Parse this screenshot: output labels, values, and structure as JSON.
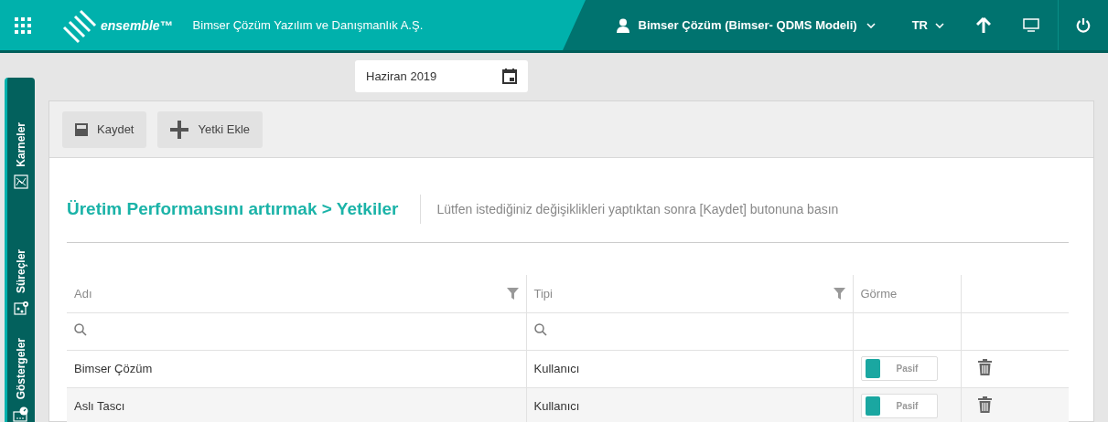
{
  "header": {
    "logo": "ensemble™",
    "company": "Bimser Çözüm Yazılım ve Danışmanlık A.Ş.",
    "user": "Bimser Çözüm (Bimser- QDMS Modeli)",
    "language": "TR"
  },
  "sidebar": {
    "items": [
      {
        "label": "Karneler"
      },
      {
        "label": "Süreçler"
      },
      {
        "label": "Göstergeler"
      }
    ]
  },
  "date_field": {
    "value": "Haziran 2019"
  },
  "toolbar": {
    "buttons": [
      {
        "label": "Kaydet"
      },
      {
        "label": "Yetki Ekle"
      }
    ]
  },
  "breadcrumb": {
    "title": "Üretim Performansını artırmak > Yetkiler",
    "hint": "Lütfen istediğiniz değişiklikleri yaptıktan sonra [Kaydet] butonuna basın"
  },
  "table": {
    "columns": [
      {
        "label": "Adı"
      },
      {
        "label": "Tipi"
      },
      {
        "label": "Görme"
      }
    ],
    "rows": [
      {
        "name": "Bimser Çözüm",
        "type": "Kullanıcı",
        "view": {
          "label": "Pasif",
          "on": false
        },
        "selected": false
      },
      {
        "name": "Aslı Tascı",
        "type": "Kullanıcı",
        "view": {
          "label": "Pasif",
          "on": false
        },
        "selected": false
      }
    ]
  }
}
